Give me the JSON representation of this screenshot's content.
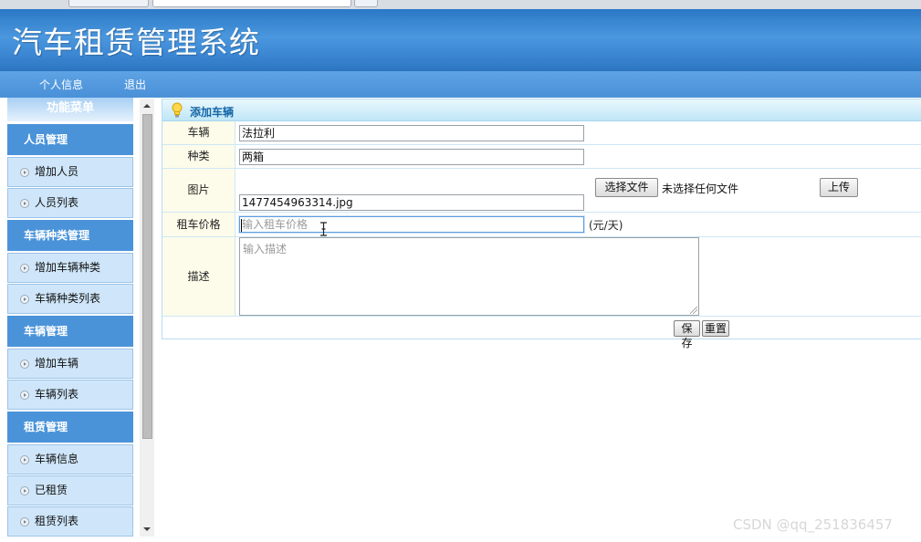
{
  "app": {
    "title": "汽车租赁管理系统"
  },
  "topnav": [
    {
      "label": "个人信息"
    },
    {
      "label": "退出"
    }
  ],
  "sidebar": {
    "title": "功能菜单",
    "groups": [
      {
        "label": "人员管理",
        "items": [
          {
            "label": "增加人员"
          },
          {
            "label": "人员列表"
          }
        ]
      },
      {
        "label": "车辆种类管理",
        "items": [
          {
            "label": "增加车辆种类"
          },
          {
            "label": "车辆种类列表"
          }
        ]
      },
      {
        "label": "车辆管理",
        "items": [
          {
            "label": "增加车辆"
          },
          {
            "label": "车辆列表"
          }
        ]
      },
      {
        "label": "租赁管理",
        "items": [
          {
            "label": "车辆信息"
          },
          {
            "label": "已租赁"
          },
          {
            "label": "租赁列表"
          }
        ]
      }
    ]
  },
  "form": {
    "heading": "添加车辆",
    "vehicle": {
      "label": "车辆",
      "value": "法拉利"
    },
    "category": {
      "label": "种类",
      "value": "两箱"
    },
    "image": {
      "label": "图片",
      "choose_button": "选择文件",
      "no_file_text": "未选择任何文件",
      "upload_button": "上传",
      "filename": "1477454963314.jpg"
    },
    "price": {
      "label": "租车价格",
      "placeholder": "输入租车价格",
      "unit": "(元/天)"
    },
    "description": {
      "label": "描述",
      "placeholder": "输入描述"
    },
    "save_button": "保存",
    "reset_button": "重置"
  },
  "watermark": "CSDN @qq_251836457",
  "colors": {
    "banner": "#3a86d2",
    "nav": "#4a90d8",
    "menu_group": "#4a93d9",
    "menu_item": "#cfe6fa",
    "label_cell": "#fdfcea",
    "panel_title": "#1466a6"
  }
}
